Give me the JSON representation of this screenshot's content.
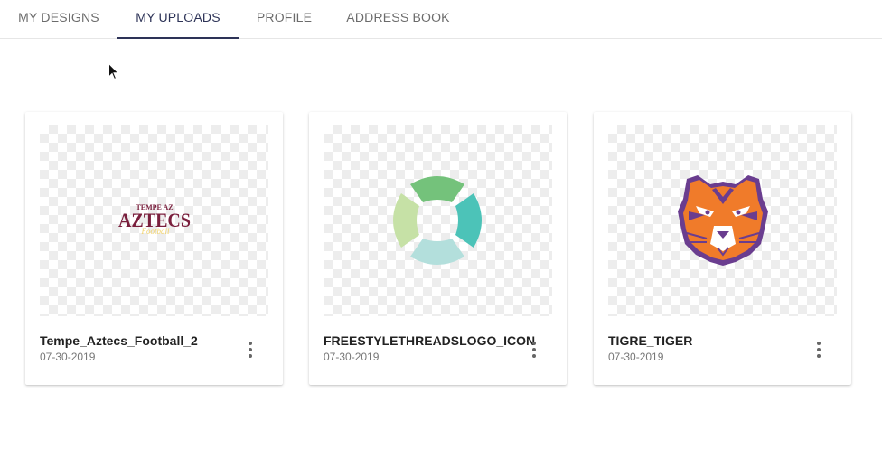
{
  "tabs": [
    {
      "label": "MY DESIGNS",
      "active": false
    },
    {
      "label": "MY UPLOADS",
      "active": true
    },
    {
      "label": "PROFILE",
      "active": false
    },
    {
      "label": "ADDRESS BOOK",
      "active": false
    }
  ],
  "uploads": [
    {
      "name": "Tempe_Aztecs_Football_2",
      "date": "07-30-2019",
      "artwork": {
        "top_text": "TEMPE AZ",
        "main_text": "AZTECS",
        "script_text": "Football"
      }
    },
    {
      "name": "FREESTYLETHREADSLOGO_ICON",
      "date": "07-30-2019"
    },
    {
      "name": "TIGRE_TIGER",
      "date": "07-30-2019"
    }
  ],
  "colors": {
    "tab_active": "#2d3357",
    "tab_inactive": "#6b6b6b",
    "aztecs_maroon": "#7a1f3d",
    "aztecs_gold": "#f2d36b",
    "logo_green_dark": "#74c27b",
    "logo_teal": "#4cc3b8",
    "logo_green_light": "#c6e1a6",
    "logo_mint": "#b3dfdc",
    "tiger_orange": "#f07b2a",
    "tiger_purple": "#6a3d8f"
  },
  "icons": [
    "more-vert-icon",
    "mouse-pointer-icon"
  ]
}
